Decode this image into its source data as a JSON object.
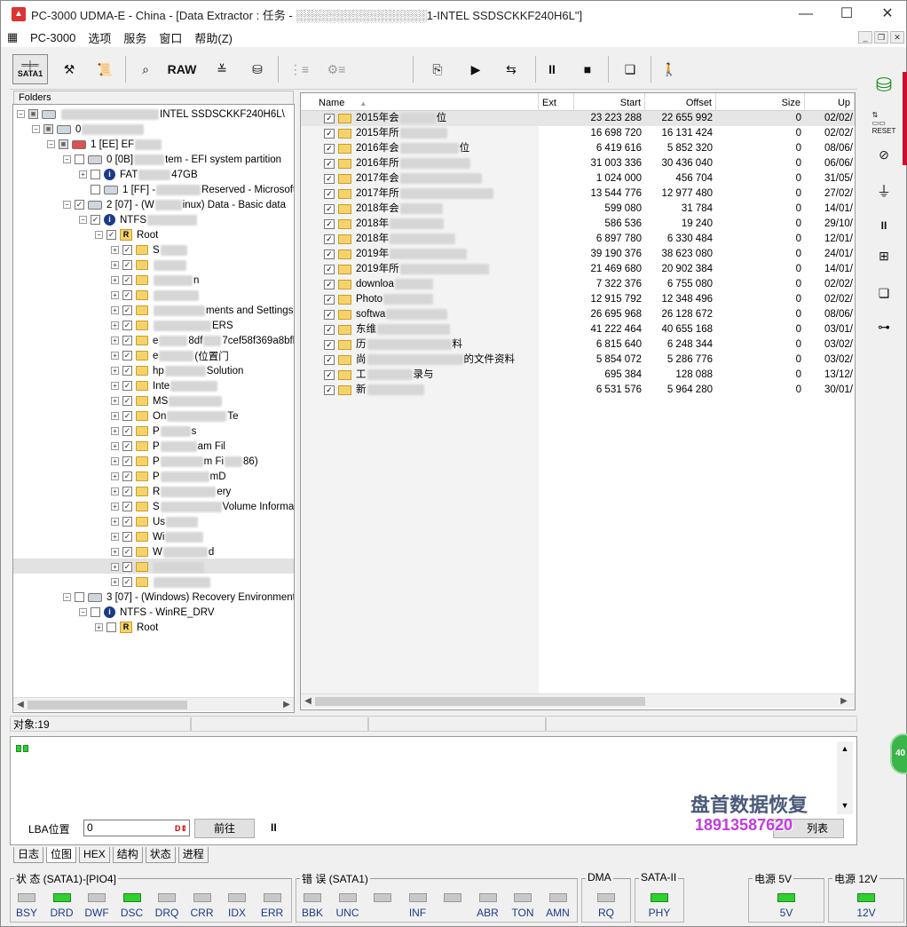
{
  "window": {
    "title": "PC-3000 UDMA-E - China - [Data Extractor : 任务 - ░░░░░░░░░░░░░░░░1-INTEL SSDSCKKF240H6L\"]",
    "minimize": "—",
    "maximize": "☐",
    "close": "✕"
  },
  "menu": {
    "items": [
      "PC-3000",
      "选项",
      "服务",
      "窗口",
      "帮助(Z)"
    ]
  },
  "toolbar": {
    "sata_label": "SATA1",
    "raw_label": "RAW"
  },
  "folders_header": "Folders",
  "tree": {
    "root_label": "INTEL SSDSCKKF240H6L\\",
    "disk0": "0",
    "p1": "1 [EE] EF",
    "p1_0": "0 [0B]",
    "p1_0_desc": "tem - EFI system partition",
    "fat": "FAT",
    "fat_size": "47GB",
    "p1_1": "1 [FF] -",
    "p1_1_desc": "Reserved - Microsoft re",
    "p1_2": "2 [07] - (W",
    "p1_2_desc": "inux) Data - Basic data",
    "ntfs": "NTFS",
    "root": "Root",
    "items": [
      {
        "a": "S",
        "b": ""
      },
      {
        "a": "",
        "b": ""
      },
      {
        "a": "",
        "b": "n"
      },
      {
        "a": "",
        "b": ""
      },
      {
        "a": "",
        "b": "ments and Settings"
      },
      {
        "a": "",
        "b": "ERS"
      },
      {
        "a": "e",
        "b": "8df",
        "c": "7cef58f369a8bfl"
      },
      {
        "a": "e",
        "b": "(位置门"
      },
      {
        "a": "hp",
        "b": "Solution"
      },
      {
        "a": "Inte",
        "b": ""
      },
      {
        "a": "MS",
        "b": ""
      },
      {
        "a": "On",
        "b": "Te"
      },
      {
        "a": "P",
        "b": "s"
      },
      {
        "a": "P",
        "b": "am Fil"
      },
      {
        "a": "P",
        "b": "m Fi",
        "c": "86)"
      },
      {
        "a": "P",
        "b": "mD"
      },
      {
        "a": "R",
        "b": "ery"
      },
      {
        "a": "S",
        "b": "Volume Information"
      },
      {
        "a": "Us",
        "b": ""
      },
      {
        "a": "Wi",
        "b": ""
      },
      {
        "a": "W",
        "b": "d"
      },
      {
        "a": "",
        "b": ""
      },
      {
        "a": "",
        "b": ""
      }
    ],
    "p3": "3 [07] - (Windows) Recovery Environment",
    "winre": "NTFS - WinRE_DRV",
    "root2": "Root"
  },
  "list": {
    "columns": [
      "Name",
      "Ext",
      "Start",
      "Offset",
      "Size",
      "Up"
    ],
    "rows": [
      {
        "name": "2015年会",
        "tail": "位",
        "start": "23 223 288",
        "offset": "22 655 992",
        "size": "0",
        "date": "02/02/"
      },
      {
        "name": "2015年所",
        "tail": "",
        "start": "16 698 720",
        "offset": "16 131 424",
        "size": "0",
        "date": "02/02/"
      },
      {
        "name": "2016年会",
        "tail": "位",
        "start": "6 419 616",
        "offset": "5 852 320",
        "size": "0",
        "date": "08/06/"
      },
      {
        "name": "2016年所",
        "tail": "",
        "start": "31 003 336",
        "offset": "30 436 040",
        "size": "0",
        "date": "06/06/"
      },
      {
        "name": "2017年会",
        "tail": "",
        "start": "1 024 000",
        "offset": "456 704",
        "size": "0",
        "date": "31/05/"
      },
      {
        "name": "2017年所",
        "tail": "",
        "start": "13 544 776",
        "offset": "12 977 480",
        "size": "0",
        "date": "27/02/"
      },
      {
        "name": "2018年会",
        "tail": "",
        "start": "599 080",
        "offset": "31 784",
        "size": "0",
        "date": "14/01/"
      },
      {
        "name": "2018年",
        "tail": "",
        "start": "586 536",
        "offset": "19 240",
        "size": "0",
        "date": "29/10/"
      },
      {
        "name": "2018年",
        "tail": "",
        "start": "6 897 780",
        "offset": "6 330 484",
        "size": "0",
        "date": "12/01/"
      },
      {
        "name": "2019年",
        "tail": "",
        "start": "39 190 376",
        "offset": "38 623 080",
        "size": "0",
        "date": "24/01/"
      },
      {
        "name": "2019年所",
        "tail": "",
        "start": "21 469 680",
        "offset": "20 902 384",
        "size": "0",
        "date": "14/01/"
      },
      {
        "name": "downloa",
        "tail": "",
        "start": "7 322 376",
        "offset": "6 755 080",
        "size": "0",
        "date": "02/02/"
      },
      {
        "name": "Photo",
        "tail": "",
        "start": "12 915 792",
        "offset": "12 348 496",
        "size": "0",
        "date": "02/02/"
      },
      {
        "name": "softwa",
        "tail": "",
        "start": "26 695 968",
        "offset": "26 128 672",
        "size": "0",
        "date": "08/06/"
      },
      {
        "name": "东维",
        "tail": "",
        "start": "41 222 464",
        "offset": "40 655 168",
        "size": "0",
        "date": "03/01/"
      },
      {
        "name": "历",
        "tail": "料",
        "start": "6 815 640",
        "offset": "6 248 344",
        "size": "0",
        "date": "03/02/"
      },
      {
        "name": "尚",
        "tail": "的文件资料",
        "start": "5 854 072",
        "offset": "5 286 776",
        "size": "0",
        "date": "03/02/"
      },
      {
        "name": "工",
        "tail": "录与",
        "start": "695 384",
        "offset": "128 088",
        "size": "0",
        "date": "13/12/"
      },
      {
        "name": "新",
        "tail": "",
        "start": "6 531 576",
        "offset": "5 964 280",
        "size": "0",
        "date": "30/01/"
      }
    ]
  },
  "status": {
    "objects": "对象:19"
  },
  "lba": {
    "label": "LBA位置",
    "value": "0",
    "d_marker": "D⇕",
    "go_button": "前往",
    "pause": "II",
    "list_button": "列表"
  },
  "watermark": {
    "company": "盘首数据恢复",
    "phone": "18913587620"
  },
  "tabs": [
    "日志",
    "位图",
    "HEX",
    "结构",
    "状态",
    "进程"
  ],
  "indicators": {
    "status_label": "状 态 (SATA1)-[PIO4]",
    "status_leds": [
      {
        "name": "BSY",
        "on": false
      },
      {
        "name": "DRD",
        "on": true
      },
      {
        "name": "DWF",
        "on": false
      },
      {
        "name": "DSC",
        "on": true
      },
      {
        "name": "DRQ",
        "on": false
      },
      {
        "name": "CRR",
        "on": false
      },
      {
        "name": "IDX",
        "on": false
      },
      {
        "name": "ERR",
        "on": false
      }
    ],
    "error_label": "错 误 (SATA1)",
    "error_leds": [
      {
        "name": "BBK",
        "on": false
      },
      {
        "name": "UNC",
        "on": false
      },
      {
        "name": "",
        "on": false
      },
      {
        "name": "INF",
        "on": false
      },
      {
        "name": "",
        "on": false
      },
      {
        "name": "ABR",
        "on": false
      },
      {
        "name": "TON",
        "on": false
      },
      {
        "name": "AMN",
        "on": false
      }
    ],
    "dma_label": "DMA",
    "dma_led": {
      "name": "RQ",
      "on": false
    },
    "sata_label": "SATA-II",
    "sata_led": {
      "name": "PHY",
      "on": true
    },
    "p5_label": "电源 5V",
    "p5_led": {
      "name": "5V",
      "on": true
    },
    "p12_label": "电源 12V",
    "p12_led": {
      "name": "12V",
      "on": true
    }
  },
  "side_badge": "40",
  "colors": {
    "led_on": "#2fd02f",
    "led_off": "#c8c8c8",
    "accent_red": "#c8102e",
    "watermark_phone": "#c33be0"
  }
}
